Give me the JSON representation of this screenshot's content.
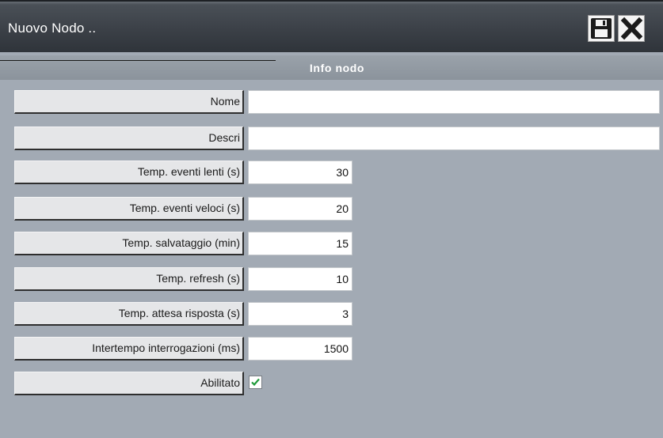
{
  "window": {
    "title": "Nuovo Nodo ..",
    "save_icon": "floppy-disk-icon",
    "close_icon": "close-x-icon"
  },
  "section": {
    "title": "Info nodo"
  },
  "fields": {
    "nome": {
      "label": "Nome",
      "value": ""
    },
    "descri": {
      "label": "Descri",
      "value": ""
    },
    "temp_eventi_lenti": {
      "label": "Temp. eventi lenti (s)",
      "value": "30"
    },
    "temp_eventi_veloci": {
      "label": "Temp. eventi veloci (s)",
      "value": "20"
    },
    "temp_salvataggio": {
      "label": "Temp. salvataggio (min)",
      "value": "15"
    },
    "temp_refresh": {
      "label": "Temp. refresh (s)",
      "value": "10"
    },
    "temp_attesa_risposta": {
      "label": "Temp. attesa risposta (s)",
      "value": "3"
    },
    "intertempo_interrogazioni": {
      "label": "Intertempo interrogazioni (ms)",
      "value": "1500"
    },
    "abilitato": {
      "label": "Abilitato",
      "checked": true
    }
  },
  "colors": {
    "background": "#a2aab4",
    "titlebar": "#3c4148",
    "checkmark": "#1f9a3a"
  }
}
